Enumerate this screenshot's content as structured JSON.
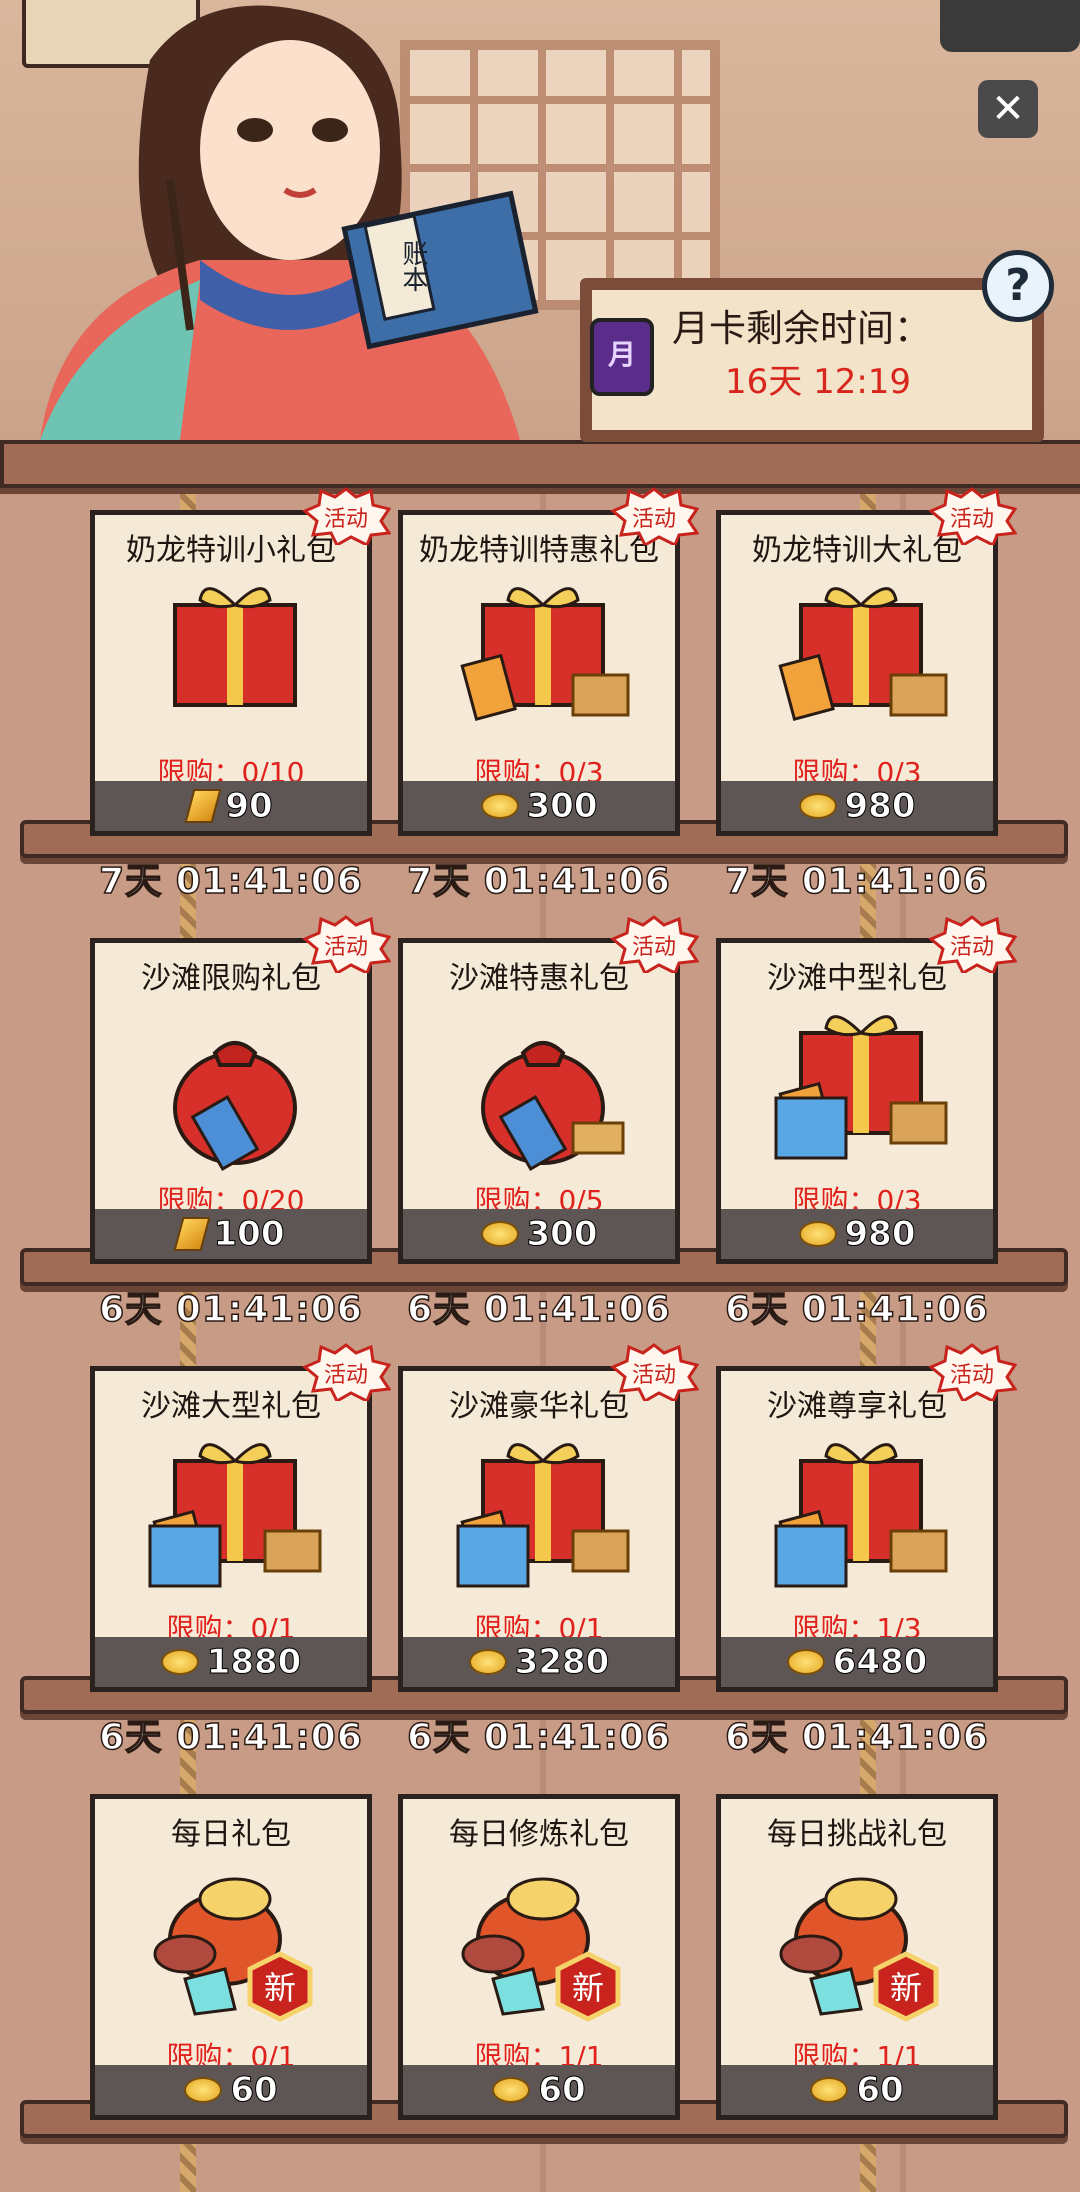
{
  "month_card": {
    "label": "月卡剩余时间：",
    "remaining": "16天 12:19",
    "icon": "month-card-icon"
  },
  "header": {
    "close_label": "✕",
    "help_label": "?",
    "book_text": "账本"
  },
  "badge_label": "活动",
  "rows": [
    {
      "timers": [
        "7天 01:41:06",
        "7天 01:41:06",
        "7天 01:41:06"
      ],
      "packs": [
        {
          "title": "奶龙特训小礼包",
          "limit": "限购：0/10",
          "price": "90",
          "currency": "gold-bar",
          "art": "small-gift-box",
          "badge": true
        },
        {
          "title": "奶龙特训特惠礼包",
          "limit": "限购：0/3",
          "price": "300",
          "currency": "gold-coin",
          "art": "gift-box-with-tickets",
          "badge": true
        },
        {
          "title": "奶龙特训大礼包",
          "limit": "限购：0/3",
          "price": "980",
          "currency": "gold-coin",
          "art": "big-gift-box-with-tickets",
          "badge": true
        }
      ]
    },
    {
      "timers": [
        "6天 01:41:06",
        "6天 01:41:06",
        "6天 01:41:06"
      ],
      "packs": [
        {
          "title": "沙滩限购礼包",
          "limit": "限购：0/20",
          "price": "100",
          "currency": "gold-bar",
          "art": "red-bag-with-shovel",
          "badge": true
        },
        {
          "title": "沙滩特惠礼包",
          "limit": "限购：0/5",
          "price": "300",
          "currency": "gold-coin",
          "art": "red-bag-with-shovels",
          "badge": true
        },
        {
          "title": "沙滩中型礼包",
          "limit": "限购：0/3",
          "price": "980",
          "currency": "gold-coin",
          "art": "gift-box-with-shovels",
          "badge": true
        }
      ]
    },
    {
      "timers": [
        "6天 01:41:06",
        "6天 01:41:06",
        "6天 01:41:06"
      ],
      "packs": [
        {
          "title": "沙滩大型礼包",
          "limit": "限购：0/1",
          "price": "1880",
          "currency": "gold-coin",
          "art": "gift-box-with-many-shovels",
          "badge": true
        },
        {
          "title": "沙滩豪华礼包",
          "limit": "限购：0/1",
          "price": "3280",
          "currency": "gold-coin",
          "art": "luxury-gift-box",
          "badge": true
        },
        {
          "title": "沙滩尊享礼包",
          "limit": "限购：1/3",
          "price": "6480",
          "currency": "gold-coin",
          "art": "premium-gift-box",
          "badge": true
        }
      ]
    },
    {
      "timers": [],
      "packs": [
        {
          "title": "每日礼包",
          "limit": "限购：0/1",
          "price": "60",
          "currency": "gold-coin",
          "art": "daily-bag-new",
          "badge": false,
          "new_label": "新"
        },
        {
          "title": "每日修炼礼包",
          "limit": "限购：1/1",
          "price": "60",
          "currency": "gold-coin",
          "art": "daily-bag-new",
          "badge": false,
          "new_label": "新"
        },
        {
          "title": "每日挑战礼包",
          "limit": "限购：1/1",
          "price": "60",
          "currency": "gold-coin",
          "art": "daily-bag-new",
          "badge": false,
          "new_label": "新"
        }
      ]
    }
  ],
  "colors": {
    "limit_red": "#e0211c",
    "time_red": "#d9261c",
    "wood": "#a06c56",
    "card_bg": "#f5ead7"
  }
}
